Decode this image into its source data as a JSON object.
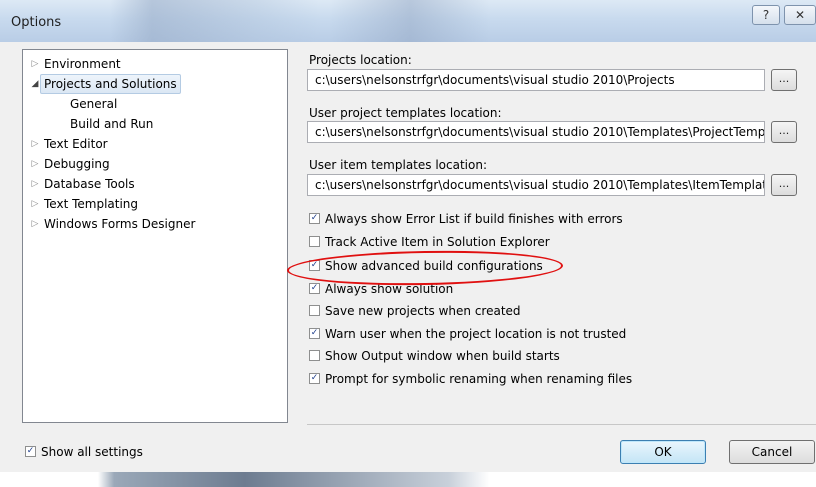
{
  "window": {
    "title": "Options",
    "help_glyph": "?",
    "close_glyph": "✕"
  },
  "tree": {
    "items": [
      {
        "label": "Environment",
        "expander": "▷"
      },
      {
        "label": "Projects and Solutions",
        "expander": "◢",
        "expanded": true,
        "selected": true
      },
      {
        "label": "General",
        "child": true
      },
      {
        "label": "Build and Run",
        "child": true
      },
      {
        "label": "Text Editor",
        "expander": "▷"
      },
      {
        "label": "Debugging",
        "expander": "▷"
      },
      {
        "label": "Database Tools",
        "expander": "▷"
      },
      {
        "label": "Text Templating",
        "expander": "▷"
      },
      {
        "label": "Windows Forms Designer",
        "expander": "▷"
      }
    ]
  },
  "locations": {
    "projects": {
      "label": "Projects location:",
      "value": "c:\\users\\nelsonstrfgr\\documents\\visual studio 2010\\Projects"
    },
    "project_templates": {
      "label": "User project templates location:",
      "value": "c:\\users\\nelsonstrfgr\\documents\\visual studio 2010\\Templates\\ProjectTemplates"
    },
    "item_templates": {
      "label": "User item templates location:",
      "value": "c:\\users\\nelsonstrfgr\\documents\\visual studio 2010\\Templates\\ItemTemplates"
    },
    "browse_label": "..."
  },
  "options": [
    {
      "label": "Always show Error List if build finishes with errors",
      "checked": true
    },
    {
      "label": "Track Active Item in Solution Explorer",
      "checked": false
    },
    {
      "label": "Show advanced build configurations",
      "checked": true
    },
    {
      "label": "Always show solution",
      "checked": true
    },
    {
      "label": "Save new projects when created",
      "checked": false
    },
    {
      "label": "Warn user when the project location is not trusted",
      "checked": true
    },
    {
      "label": "Show Output window when build starts",
      "checked": false
    },
    {
      "label": "Prompt for symbolic renaming when renaming files",
      "checked": true
    }
  ],
  "check_glyph": "✓",
  "footer": {
    "show_all_settings": {
      "label": "Show all settings",
      "checked": true
    },
    "ok_label": "OK",
    "cancel_label": "Cancel"
  },
  "colors": {
    "highlight": "#e01010",
    "selection": "#dbe7f4",
    "ok_border": "#3c7fb1"
  }
}
